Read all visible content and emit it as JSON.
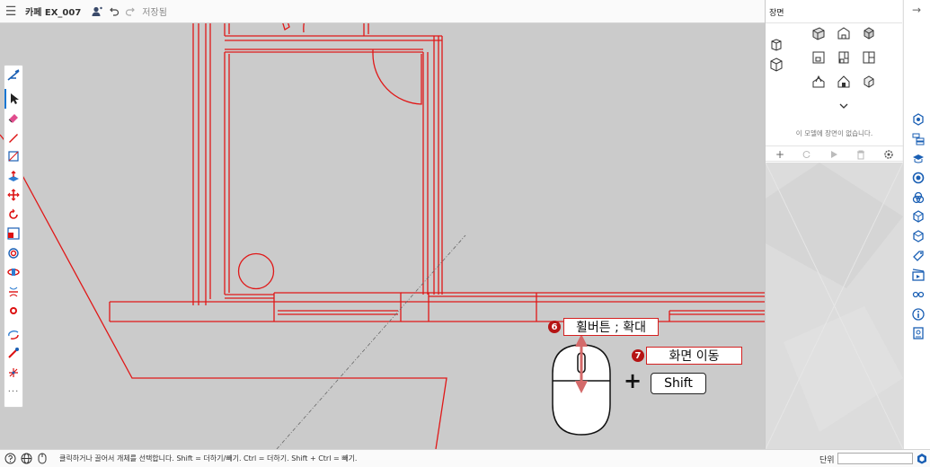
{
  "topbar": {
    "title": "카페 EX_007",
    "save_status": "저장됨"
  },
  "statusbar": {
    "hint": "클릭하거나 끌어서 개체를 선택합니다. Shift = 더하기/빼기. Ctrl = 더하기. Shift + Ctrl = 빼기.",
    "units_label": "단위",
    "units_value": ""
  },
  "panel": {
    "title": "장면",
    "empty_text": "이 모델에 장면이 없습니다."
  },
  "annotations": {
    "wheel_badge": "6",
    "wheel_label": "휠버튼 ; 확대",
    "pan_badge": "7",
    "pan_label": "화면 이동",
    "plus": "+",
    "shift_key": "Shift"
  },
  "toolbar": {
    "tools": [
      "select-tool",
      "eraser-tool",
      "pencil-tool",
      "rectangle-tool",
      "push-pull-tool",
      "move-tool",
      "rotate-tool",
      "scale-tool",
      "offset-tool",
      "follow-me-tool",
      "flip-tool",
      "paint-bucket-tool",
      "orbit-tool",
      "tape-measure-tool",
      "axes-tool",
      "more-tools"
    ]
  },
  "tray_icons": [
    "entity-info-icon",
    "outliner-icon",
    "instructor-icon",
    "materials-icon",
    "components-icon",
    "solid-tools-icon",
    "3d-warehouse-icon",
    "tags-icon",
    "scenes-icon",
    "display-icon",
    "model-info-icon",
    "extensions-icon"
  ],
  "colors": {
    "drawing_line": "#e01818",
    "annotation_red": "#b51414",
    "selection_blue": "#1976d2"
  }
}
